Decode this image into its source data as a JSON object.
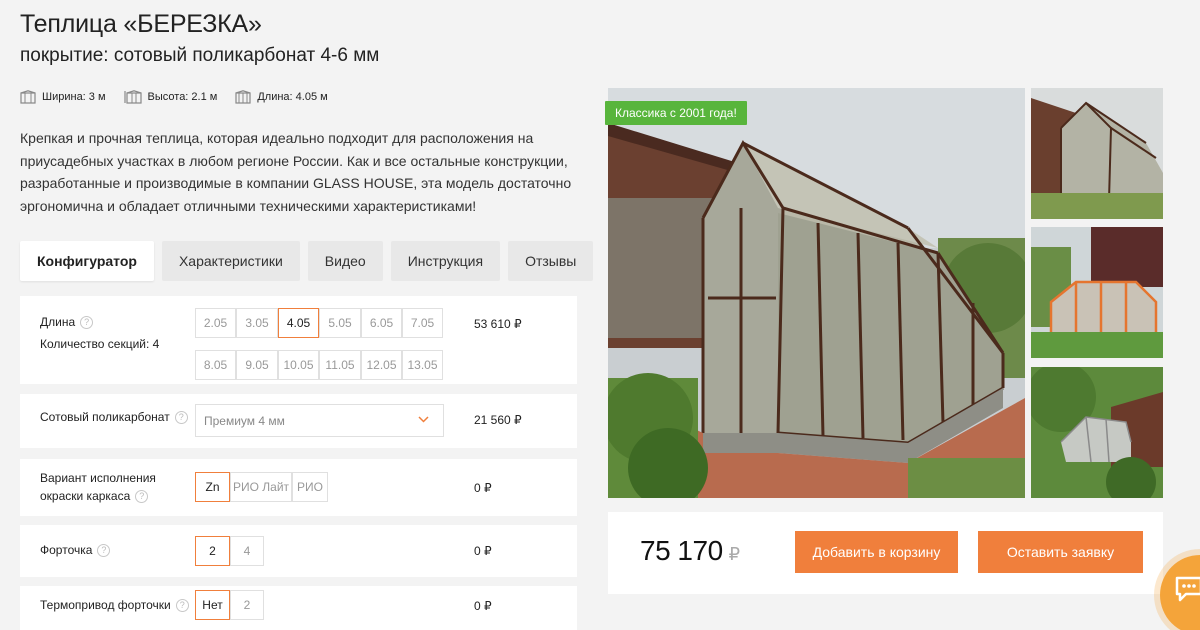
{
  "product": {
    "title": "Теплица «БЕРЕЗКА»",
    "subtitle": "покрытие: сотовый поликарбонат 4-6 мм",
    "dims": [
      {
        "icon": "width-icon",
        "text": "Ширина: 3 м"
      },
      {
        "icon": "height-icon",
        "text": "Высота: 2.1 м"
      },
      {
        "icon": "length-icon",
        "text": "Длина: 4.05 м"
      }
    ],
    "description": "Крепкая и прочная теплица, которая идеально подходит для расположения на приусадебных участках в любом регионе России. Как и все остальные конструкции, разработанные и производимые в компании GLASS HOUSE, эта модель достаточно эргономична и обладает отличными техническими характеристиками!"
  },
  "tabs": [
    "Конфигуратор",
    "Характеристики",
    "Видео",
    "Инструкция",
    "Отзывы"
  ],
  "configurator": {
    "length": {
      "label": "Длина",
      "sections": "Количество секций: 4",
      "options_row1": [
        "2.05",
        "3.05",
        "4.05",
        "5.05",
        "6.05",
        "7.05"
      ],
      "options_row2": [
        "8.05",
        "9.05",
        "10.05",
        "11.05",
        "12.05",
        "13.05"
      ],
      "selected": "4.05",
      "price": "53 610 ₽"
    },
    "polycarbonate": {
      "label": "Сотовый поликарбонат",
      "value": "Премиум 4 мм",
      "price": "21 560 ₽"
    },
    "paint": {
      "label_line1": "Вариант исполнения",
      "label_line2": "окраски каркаса",
      "options": [
        "Zn",
        "РИО Лайт",
        "РИО"
      ],
      "selected": "Zn",
      "price": "0 ₽"
    },
    "vent": {
      "label": "Форточка",
      "options": [
        "2",
        "4"
      ],
      "selected": "2",
      "price": "0 ₽"
    },
    "thermo": {
      "label": "Термопривод форточки",
      "options": [
        "Нет",
        "2"
      ],
      "selected": "Нет",
      "price": "0 ₽"
    }
  },
  "gallery": {
    "badge": "Классика с 2001 года!"
  },
  "buy": {
    "total": "75 170",
    "currency": "₽",
    "add_to_cart": "Добавить в корзину",
    "request": "Оставить заявку"
  },
  "colors": {
    "accent": "#f07f3c",
    "badge": "#58b53c",
    "chat": "#f4a43a"
  }
}
